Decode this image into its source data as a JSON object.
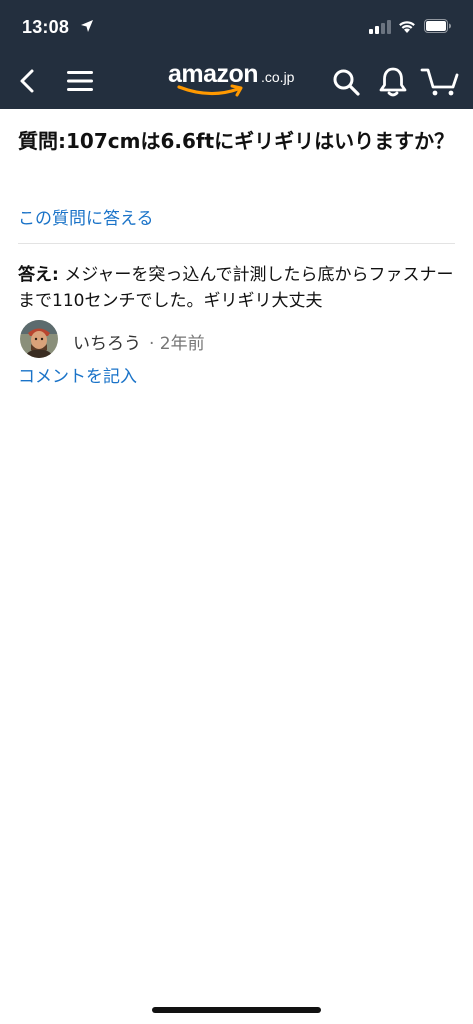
{
  "status_bar": {
    "time": "13:08",
    "icons": [
      "location-arrow-icon",
      "cellular-signal-icon",
      "wifi-icon",
      "battery-icon"
    ]
  },
  "nav": {
    "logo_text": "amazon",
    "logo_suffix": ".co.jp",
    "icons": [
      "back-icon",
      "menu-icon",
      "search-icon",
      "bell-icon",
      "cart-icon"
    ]
  },
  "question": {
    "text": "質問:107cmは6.6ftにギリギリはいりますか？",
    "answer_link": "この質問に答える"
  },
  "answer": {
    "label": "答え:",
    "text": " メジャーを突っ込んで計測したら底からファスナーまで110センチでした。ギリギリ大丈夫",
    "author": "いちろう",
    "meta": "· 2年前",
    "comment_link": "コメントを記入"
  },
  "colors": {
    "header_bg": "#232f3e",
    "link": "#1a73c8",
    "logo_smile": "#ff9900"
  }
}
